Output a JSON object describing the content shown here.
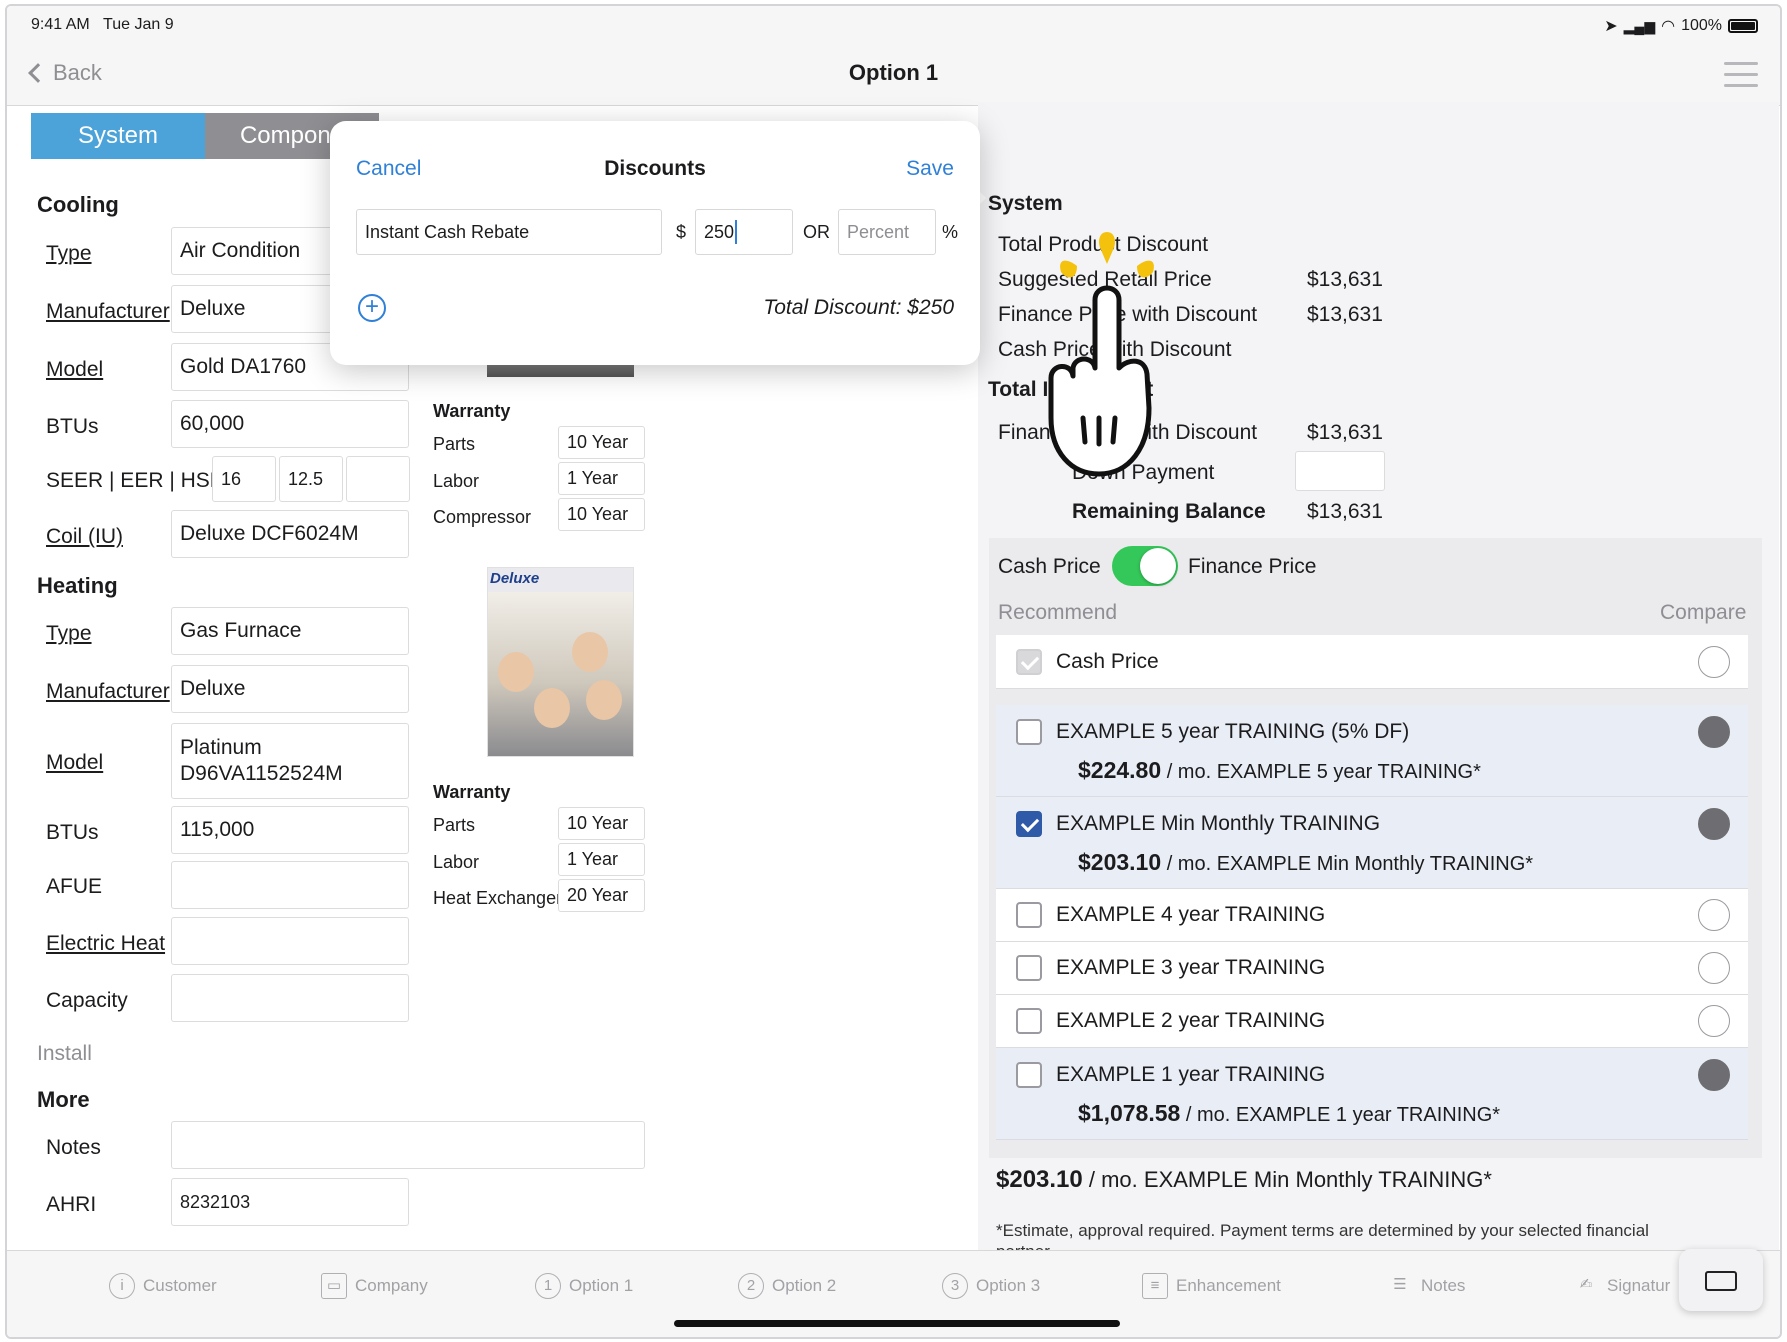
{
  "status": {
    "time": "9:41 AM",
    "date": "Tue Jan 9",
    "battery": "100%"
  },
  "nav": {
    "back": "Back",
    "title": "Option 1"
  },
  "tabs_seg": {
    "system": "System",
    "components": "Compone"
  },
  "cooling": {
    "title": "Cooling",
    "type_label": "Type",
    "type": "Air Condition",
    "manufacturer_label": "Manufacturer",
    "manufacturer": "Deluxe",
    "model_label": "Model",
    "model": "Gold DA1760",
    "btus_label": "BTUs",
    "btus": "60,000",
    "seer_label": "SEER | EER | HSPF",
    "seer": "16",
    "eer": "12.5",
    "hspf": "",
    "coil_label": "Coil (IU)",
    "coil": "Deluxe DCF6024M"
  },
  "cooling_warranty": {
    "title": "Warranty",
    "rows": [
      {
        "label": "Parts",
        "value": "10 Year"
      },
      {
        "label": "Labor",
        "value": "1 Year"
      },
      {
        "label": "Compressor",
        "value": "10 Year"
      }
    ]
  },
  "heating": {
    "title": "Heating",
    "type_label": "Type",
    "type": "Gas Furnace",
    "manufacturer_label": "Manufacturer",
    "manufacturer": "Deluxe",
    "model_label": "Model",
    "model_line1": "Platinum",
    "model_line2": "D96VA1152524M",
    "btus_label": "BTUs",
    "btus": "115,000",
    "afue_label": "AFUE",
    "afue": "",
    "electric_label": "Electric Heat",
    "electric": "",
    "capacity_label": "Capacity",
    "capacity": ""
  },
  "heating_warranty": {
    "title": "Warranty",
    "rows": [
      {
        "label": "Parts",
        "value": "10 Year"
      },
      {
        "label": "Labor",
        "value": "1 Year"
      },
      {
        "label": "Heat Exchanger",
        "value": "20 Year"
      }
    ]
  },
  "brand_logo": "Deluxe",
  "install_label": "Install",
  "more": {
    "title": "More",
    "notes_label": "Notes",
    "notes": "",
    "ahri_label": "AHRI",
    "ahri": "8232103"
  },
  "summary": {
    "system_title": "System",
    "total_product_discount": "Total Product Discount",
    "srp_label": "Suggested Retail Price",
    "srp": "$13,631",
    "finance_with_discount_label": "Finance Price with Discount",
    "finance_with_discount": "$13,631",
    "cash_with_discount_label": "Cash Price with Discount",
    "total_title": "Total Investment",
    "total_finance_label": "Finance Price with Discount",
    "total_finance": "$13,631",
    "down_payment_label": "Down Payment",
    "down_payment": "",
    "remaining_label": "Remaining Balance",
    "remaining": "$13,631"
  },
  "pricing": {
    "cash_label": "Cash Price",
    "finance_label": "Finance Price",
    "recommend": "Recommend",
    "compare": "Compare",
    "options": [
      {
        "name": "Cash Price",
        "amount": "",
        "desc": ""
      },
      {
        "name": "EXAMPLE 5 year TRAINING (5% DF)",
        "amount": "$224.80",
        "desc": " / mo. EXAMPLE 5 year TRAINING*"
      },
      {
        "name": "EXAMPLE Min Monthly TRAINING",
        "amount": "$203.10",
        "desc": " / mo. EXAMPLE Min Monthly TRAINING*"
      },
      {
        "name": "EXAMPLE 4 year TRAINING",
        "amount": "",
        "desc": ""
      },
      {
        "name": "EXAMPLE 3 year TRAINING",
        "amount": "",
        "desc": ""
      },
      {
        "name": "EXAMPLE 2 year TRAINING",
        "amount": "",
        "desc": ""
      },
      {
        "name": "EXAMPLE 1 year TRAINING",
        "amount": "$1,078.58",
        "desc": " / mo. EXAMPLE 1 year TRAINING*"
      }
    ],
    "selected_amount": "$203.10",
    "selected_desc": " / mo. EXAMPLE Min Monthly TRAINING*",
    "disclaimer": "*Estimate, approval required. Payment terms are determined by your selected financial partner."
  },
  "popover": {
    "cancel": "Cancel",
    "title": "Discounts",
    "save": "Save",
    "discount_name": "Instant Cash Rebate",
    "dollar": "$",
    "amount": "250",
    "or": "OR",
    "percent_placeholder": "Percent",
    "percent_sign": "%",
    "total": "Total Discount: $250"
  },
  "tabbar": {
    "customer": "Customer",
    "company": "Company",
    "option1": "Option 1",
    "option2": "Option 2",
    "option3": "Option 3",
    "enhancement": "Enhancement",
    "notes": "Notes",
    "signature": "Signatur"
  },
  "colors": {
    "accent": "#4ba3d9",
    "link": "#2f80d6",
    "toggle": "#34c759"
  }
}
